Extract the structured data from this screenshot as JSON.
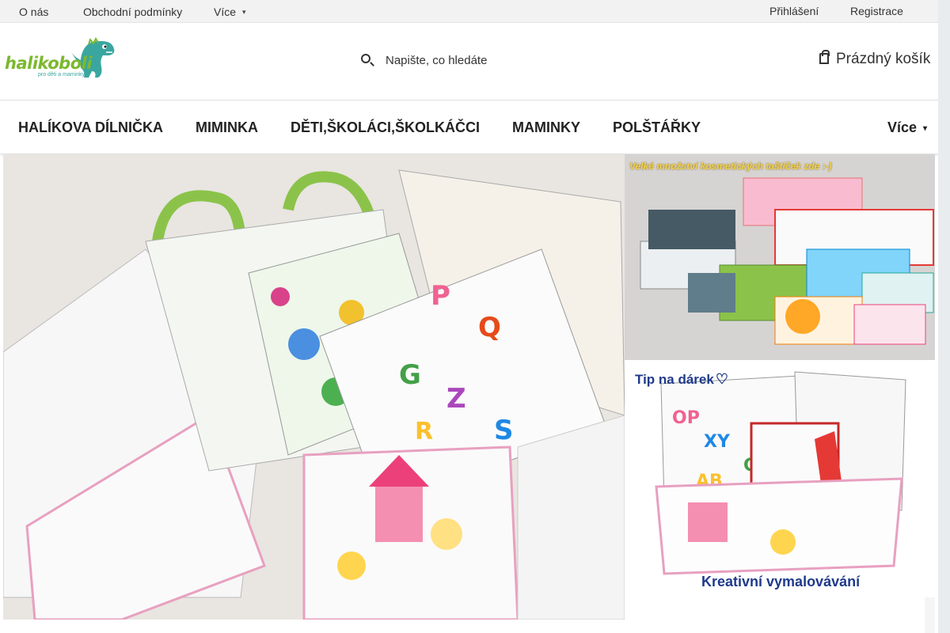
{
  "topbar": {
    "about": "O nás",
    "terms": "Obchodní podmínky",
    "more": "Více",
    "login": "Přihlášení",
    "register": "Registrace"
  },
  "header": {
    "logo_text": "halikoboli",
    "logo_sub": "pro děti a maminky",
    "search_placeholder": "Napište, co hledáte",
    "cart_label": "Prázdný košík"
  },
  "nav": {
    "items": [
      "HALÍKOVA DÍLNIČKA",
      "MIMINKA",
      "DĚTI,ŠKOLÁCI,ŠKOLKÁČCI",
      "MAMINKY",
      "POLŠTÁŘKY"
    ],
    "more": "Více"
  },
  "promos": {
    "side1_caption": "Velké množství kosmetických taštiček zde :-)",
    "side2_caption_top": "Tip na dárek",
    "side2_caption_bottom": "Kreativní vymalovávání"
  },
  "colors": {
    "brand_green": "#7cb82f",
    "brand_teal": "#3aa6a0",
    "caption_blue": "#1f3a8a",
    "caption_yellow": "#f3d24a"
  }
}
